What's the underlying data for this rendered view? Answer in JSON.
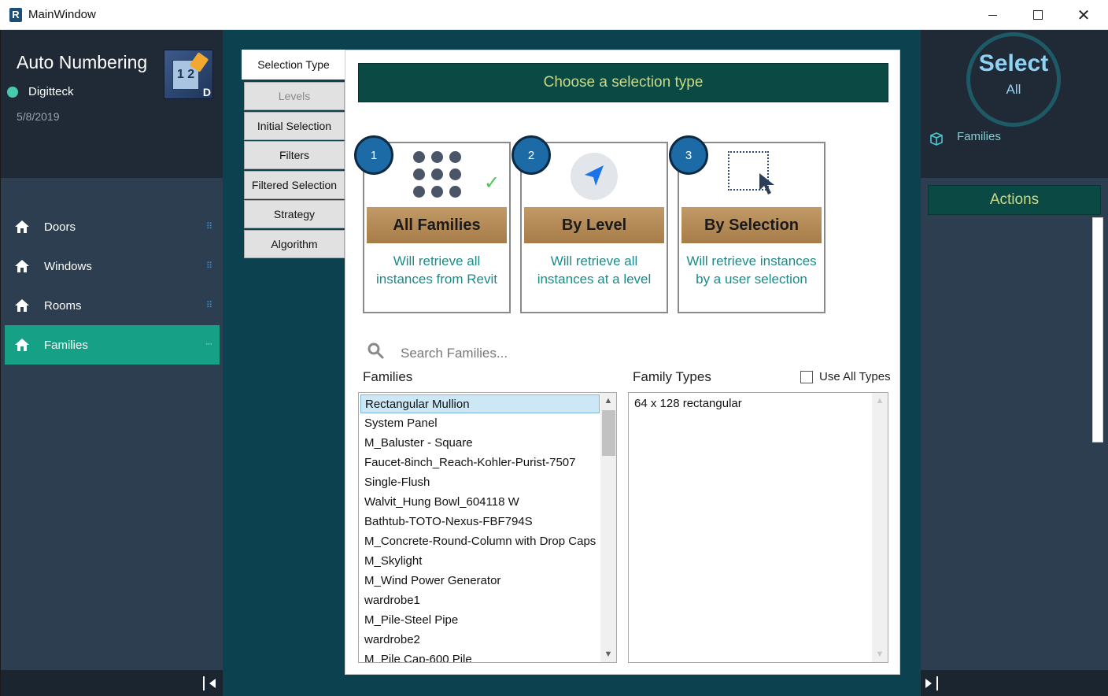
{
  "window": {
    "title": "MainWindow",
    "app_icon_letter": "R"
  },
  "left": {
    "app_name": "Auto Numbering",
    "company": "Digitteck",
    "date": "5/8/2019",
    "logo_text": "1 2",
    "logo_letter": "D",
    "nav": [
      {
        "label": "Doors",
        "dots": "⠿"
      },
      {
        "label": "Windows",
        "dots": "⠿"
      },
      {
        "label": "Rooms",
        "dots": "⠿"
      },
      {
        "label": "Families",
        "dots": "···"
      }
    ],
    "status_color": "#48c9b0",
    "active_color": "#16a085"
  },
  "tabs": [
    {
      "label": "Selection Type",
      "state": "selected"
    },
    {
      "label": "Levels",
      "state": "disabled"
    },
    {
      "label": "Initial Selection",
      "state": "normal"
    },
    {
      "label": "Filters",
      "state": "normal"
    },
    {
      "label": "Filtered Selection",
      "state": "normal"
    },
    {
      "label": "Strategy",
      "state": "normal"
    },
    {
      "label": "Algorithm",
      "state": "normal"
    }
  ],
  "main": {
    "banner": "Choose a selection type",
    "cards": [
      {
        "number": "1",
        "title": "All Families",
        "desc": "Will retrieve all instances from Revit",
        "icon": "dots-grid-icon",
        "checked": true
      },
      {
        "number": "2",
        "title": "By Level",
        "desc": "Will retrieve all instances at a level",
        "icon": "navigation-arrow-icon"
      },
      {
        "number": "3",
        "title": "By Selection",
        "desc": "Will retrieve instances by a user selection",
        "icon": "selection-box-icon"
      }
    ],
    "search_placeholder": "Search Families...",
    "families_label": "Families",
    "types_label": "Family Types",
    "use_all_types": "Use All Types",
    "families": [
      "Rectangular Mullion",
      "System Panel",
      "M_Baluster - Square",
      "Faucet-8inch_Reach-Kohler-Purist-7507",
      "Single-Flush",
      "Walvit_Hung Bowl_604118 W",
      "Bathtub-TOTO-Nexus-FBF794S",
      "M_Concrete-Round-Column with Drop Caps",
      "M_Skylight",
      "M_Wind Power Generator",
      "wardrobe1",
      "M_Pile-Steel Pipe",
      "wardrobe2",
      "M_Pile Cap-600 Pile"
    ],
    "selected_family": "Rectangular Mullion",
    "family_types": [
      "64 x 128 rectangular"
    ]
  },
  "right": {
    "select_title": "Select",
    "select_sub": "All",
    "families_label": "Families",
    "actions_label": "Actions"
  }
}
